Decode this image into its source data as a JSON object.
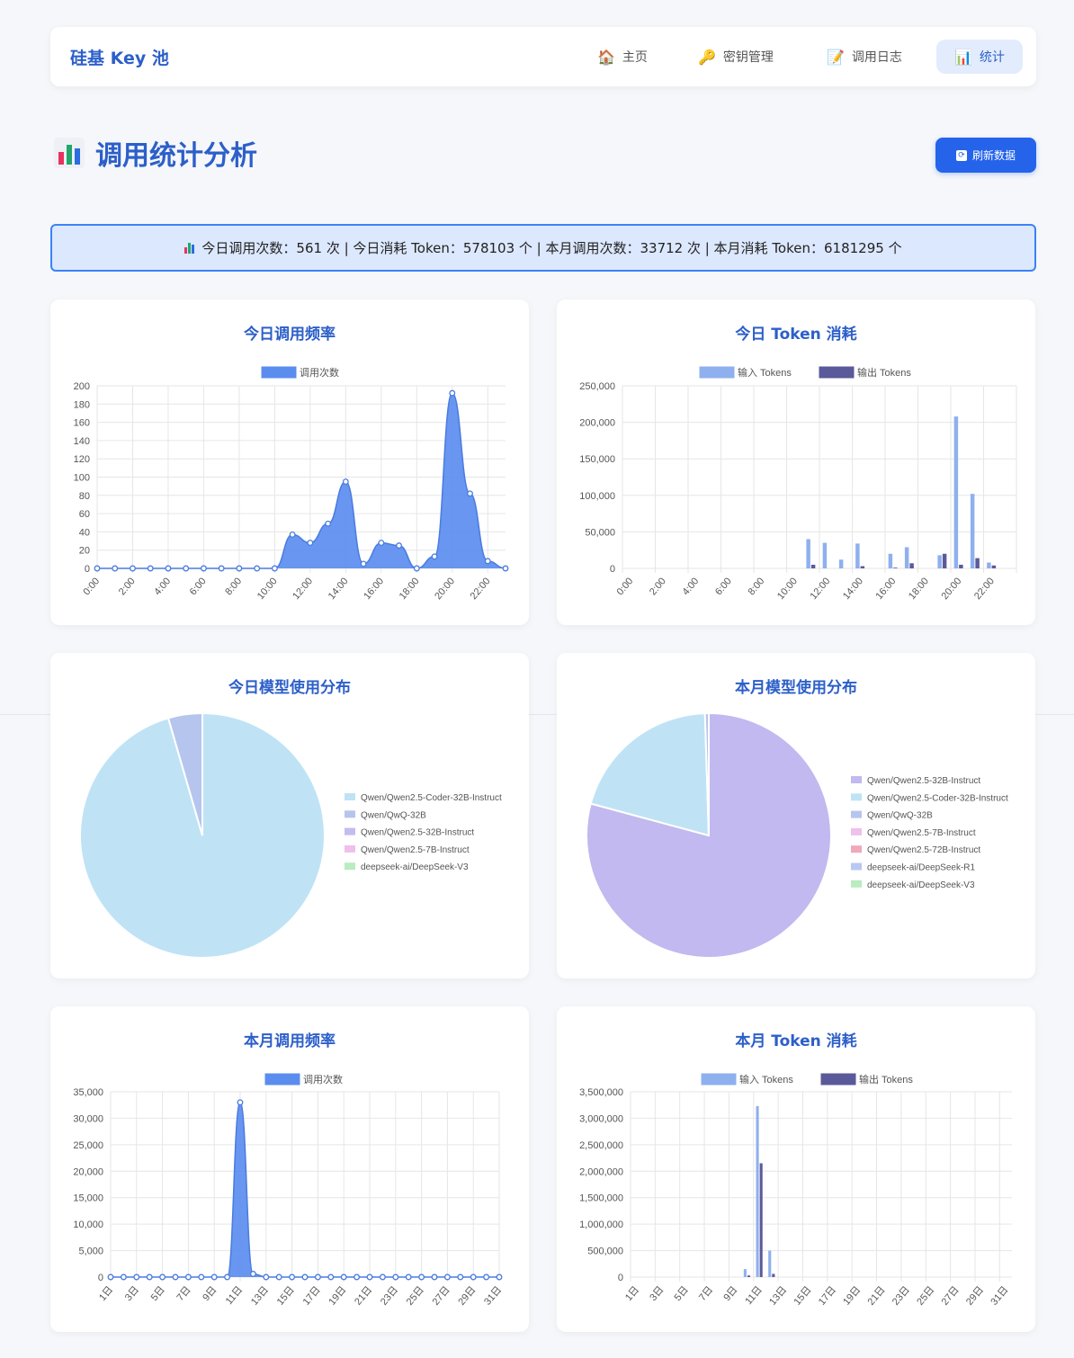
{
  "nav": {
    "brand": "硅基 Key 池",
    "items": [
      {
        "label": "主页",
        "icon": "house-icon",
        "glyph": "🏠",
        "active": false
      },
      {
        "label": "密钥管理",
        "icon": "key-icon",
        "glyph": "🔑",
        "active": false
      },
      {
        "label": "调用日志",
        "icon": "memo-icon",
        "glyph": "📝",
        "active": false
      },
      {
        "label": "统计",
        "icon": "bar-chart-icon",
        "glyph": "📊",
        "active": true
      }
    ]
  },
  "page": {
    "title": "调用统计分析",
    "refresh_label": "刷新数据"
  },
  "summary": {
    "text": "今日调用次数：561 次 | 今日消耗 Token：578103 个 | 本月调用次数：33712 次 | 本月消耗 Token：6181295 个"
  },
  "colors": {
    "accent": "#2563eb",
    "line_fill": "#5b8def",
    "input_tokens": "#8fb0ee",
    "output_tokens": "#5a5a9a"
  },
  "chart_data": [
    {
      "id": "today-calls",
      "type": "area",
      "title": "今日调用频率",
      "series": [
        {
          "name": "调用次数",
          "values": [
            0,
            0,
            0,
            0,
            0,
            0,
            0,
            0,
            0,
            0,
            0,
            37,
            28,
            49,
            95,
            5,
            28,
            25,
            0,
            13,
            192,
            82,
            8,
            0
          ]
        }
      ],
      "categories": [
        "0:00",
        "1:00",
        "2:00",
        "3:00",
        "4:00",
        "5:00",
        "6:00",
        "7:00",
        "8:00",
        "9:00",
        "10:00",
        "11:00",
        "12:00",
        "13:00",
        "14:00",
        "15:00",
        "16:00",
        "17:00",
        "18:00",
        "19:00",
        "20:00",
        "21:00",
        "22:00",
        "23:00"
      ],
      "tick_labels": [
        "0:00",
        "2:00",
        "4:00",
        "6:00",
        "8:00",
        "10:00",
        "12:00",
        "14:00",
        "16:00",
        "18:00",
        "20:00",
        "22:00"
      ],
      "y_ticks": [
        "0",
        "20",
        "40",
        "60",
        "80",
        "100",
        "120",
        "140",
        "160",
        "180",
        "200"
      ],
      "ylim": [
        0,
        200
      ],
      "legend": "top"
    },
    {
      "id": "today-tokens",
      "type": "bar",
      "title": "今日 Token 消耗",
      "series": [
        {
          "name": "输入 Tokens",
          "values": [
            0,
            0,
            0,
            0,
            0,
            0,
            0,
            0,
            0,
            0,
            0,
            40000,
            35000,
            12000,
            34000,
            0,
            20000,
            29000,
            0,
            18000,
            208000,
            102000,
            8000,
            0
          ]
        },
        {
          "name": "输出 Tokens",
          "values": [
            0,
            0,
            0,
            0,
            0,
            0,
            0,
            0,
            0,
            0,
            0,
            5000,
            0,
            0,
            3000,
            0,
            1000,
            7000,
            0,
            20000,
            5000,
            14000,
            4000,
            0
          ]
        }
      ],
      "categories": [
        "0:00",
        "1:00",
        "2:00",
        "3:00",
        "4:00",
        "5:00",
        "6:00",
        "7:00",
        "8:00",
        "9:00",
        "10:00",
        "11:00",
        "12:00",
        "13:00",
        "14:00",
        "15:00",
        "16:00",
        "17:00",
        "18:00",
        "19:00",
        "20:00",
        "21:00",
        "22:00",
        "23:00"
      ],
      "tick_labels": [
        "0:00",
        "2:00",
        "4:00",
        "6:00",
        "8:00",
        "10:00",
        "12:00",
        "14:00",
        "16:00",
        "18:00",
        "20:00",
        "22:00"
      ],
      "y_ticks": [
        "0",
        "50,000",
        "100,000",
        "150,000",
        "200,000",
        "250,000"
      ],
      "ylim": [
        0,
        250000
      ],
      "legend": "top"
    },
    {
      "id": "today-models",
      "type": "pie",
      "title": "今日模型使用分布",
      "labels": [
        "Qwen/Qwen2.5-Coder-32B-Instruct",
        "Qwen/QwQ-32B",
        "Qwen/Qwen2.5-32B-Instruct",
        "Qwen/Qwen2.5-7B-Instruct",
        "deepseek-ai/DeepSeek-V3"
      ],
      "values": [
        95.5,
        4.5,
        0,
        0,
        0
      ],
      "colors": [
        "#bfe3f5",
        "#b6c5ee",
        "#c4bbef",
        "#efc0ec",
        "#b9ecbf"
      ],
      "legend": "right"
    },
    {
      "id": "month-models",
      "type": "pie",
      "title": "本月模型使用分布",
      "labels": [
        "Qwen/Qwen2.5-32B-Instruct",
        "Qwen/Qwen2.5-Coder-32B-Instruct",
        "Qwen/QwQ-32B",
        "Qwen/Qwen2.5-7B-Instruct",
        "Qwen/Qwen2.5-72B-Instruct",
        "deepseek-ai/DeepSeek-R1",
        "deepseek-ai/DeepSeek-V3"
      ],
      "values": [
        79.2,
        20.3,
        0.5,
        0,
        0,
        0,
        0
      ],
      "colors": [
        "#c1b9ef",
        "#bfe3f5",
        "#b6c5ee",
        "#efc0ec",
        "#efa9b8",
        "#b9c7f3",
        "#b9ecbf"
      ],
      "legend": "right"
    },
    {
      "id": "month-calls",
      "type": "area",
      "title": "本月调用频率",
      "series": [
        {
          "name": "调用次数",
          "values": [
            0,
            0,
            0,
            0,
            0,
            0,
            0,
            0,
            0,
            0,
            33000,
            600,
            0,
            0,
            0,
            0,
            0,
            0,
            0,
            0,
            0,
            0,
            0,
            0,
            0,
            0,
            0,
            0,
            0,
            0,
            0
          ]
        }
      ],
      "categories": [
        "1日",
        "2日",
        "3日",
        "4日",
        "5日",
        "6日",
        "7日",
        "8日",
        "9日",
        "10日",
        "11日",
        "12日",
        "13日",
        "14日",
        "15日",
        "16日",
        "17日",
        "18日",
        "19日",
        "20日",
        "21日",
        "22日",
        "23日",
        "24日",
        "25日",
        "26日",
        "27日",
        "28日",
        "29日",
        "30日",
        "31日"
      ],
      "tick_labels": [
        "1日",
        "3日",
        "5日",
        "7日",
        "9日",
        "11日",
        "13日",
        "15日",
        "17日",
        "19日",
        "21日",
        "23日",
        "25日",
        "27日",
        "29日",
        "31日"
      ],
      "y_ticks": [
        "0",
        "5,000",
        "10,000",
        "15,000",
        "20,000",
        "25,000",
        "30,000",
        "35,000"
      ],
      "ylim": [
        0,
        35000
      ],
      "legend": "top"
    },
    {
      "id": "month-tokens",
      "type": "bar",
      "title": "本月 Token 消耗",
      "series": [
        {
          "name": "输入 Tokens",
          "values": [
            0,
            0,
            0,
            0,
            0,
            0,
            0,
            0,
            0,
            150000,
            3230000,
            500000,
            0,
            0,
            0,
            0,
            0,
            0,
            0,
            0,
            0,
            0,
            0,
            0,
            0,
            0,
            0,
            0,
            0,
            0,
            0
          ]
        },
        {
          "name": "输出 Tokens",
          "values": [
            0,
            0,
            0,
            0,
            0,
            0,
            0,
            0,
            0,
            30000,
            2150000,
            60000,
            0,
            0,
            0,
            0,
            0,
            0,
            0,
            0,
            0,
            0,
            0,
            0,
            0,
            0,
            0,
            0,
            0,
            0,
            0
          ]
        }
      ],
      "categories": [
        "1日",
        "2日",
        "3日",
        "4日",
        "5日",
        "6日",
        "7日",
        "8日",
        "9日",
        "10日",
        "11日",
        "12日",
        "13日",
        "14日",
        "15日",
        "16日",
        "17日",
        "18日",
        "19日",
        "20日",
        "21日",
        "22日",
        "23日",
        "24日",
        "25日",
        "26日",
        "27日",
        "28日",
        "29日",
        "30日",
        "31日"
      ],
      "tick_labels": [
        "1日",
        "3日",
        "5日",
        "7日",
        "9日",
        "11日",
        "13日",
        "15日",
        "17日",
        "19日",
        "21日",
        "23日",
        "25日",
        "27日",
        "29日",
        "31日"
      ],
      "y_ticks": [
        "0",
        "500,000",
        "1,000,000",
        "1,500,000",
        "2,000,000",
        "2,500,000",
        "3,000,000",
        "3,500,000"
      ],
      "ylim": [
        0,
        3500000
      ],
      "legend": "top"
    }
  ]
}
